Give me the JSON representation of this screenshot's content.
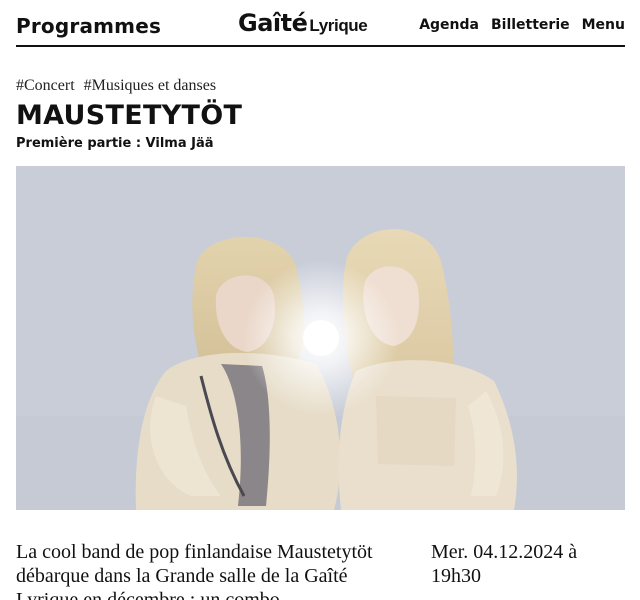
{
  "header": {
    "nav_left": "Programmes",
    "logo_main": "Gaîté",
    "logo_sub": "Lyrique",
    "nav_right": [
      "Agenda",
      "Billetterie",
      "Menu"
    ]
  },
  "event": {
    "tags": [
      "#Concert",
      "#Musiques et danses"
    ],
    "title": "MAUSTETYTÖT",
    "subtitle": "Première partie : Vilma Jää",
    "description": "La cool band de pop finlandaise Maustetytöt débarque dans la Grande salle de la Gaîté Lyrique en décembre : un combo",
    "date": "Mer. 04.12.2024 à 19h30"
  },
  "colors": {
    "text": "#111111",
    "background": "#ffffff",
    "hero_bg": "#c9ced8"
  }
}
